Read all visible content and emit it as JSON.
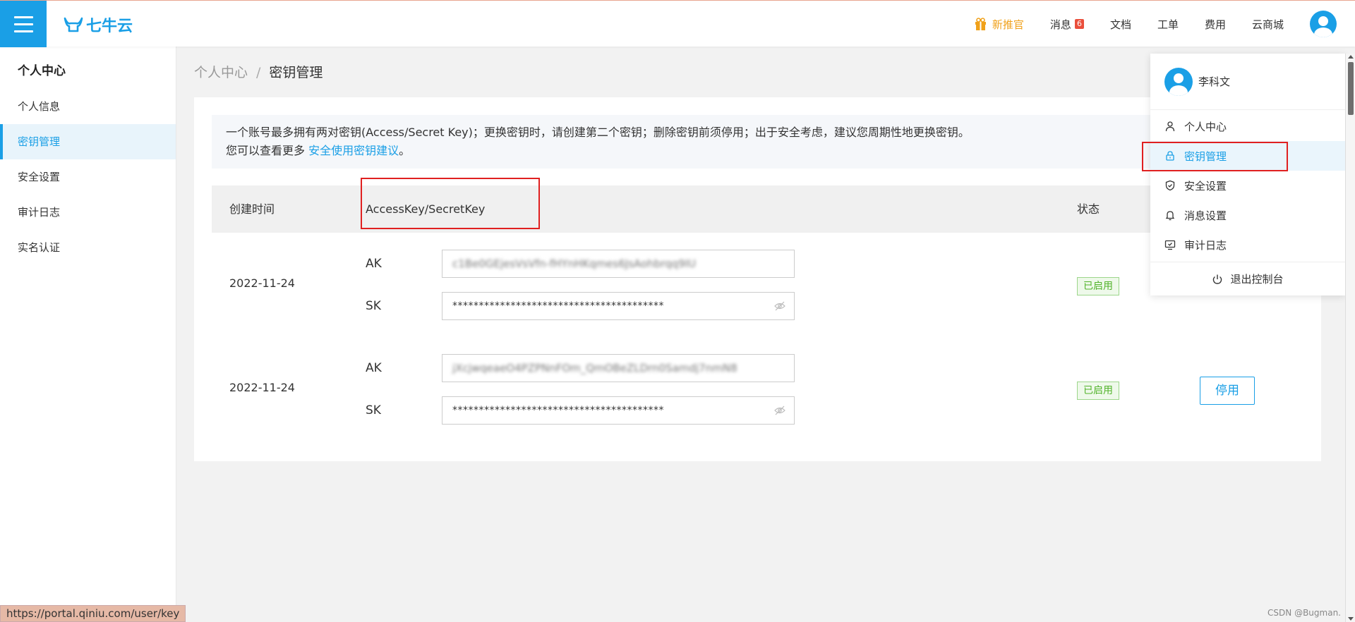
{
  "header": {
    "logo_text": "七牛云",
    "nav": {
      "promo": "新推官",
      "messages": "消息",
      "message_count": "6",
      "docs": "文档",
      "tickets": "工单",
      "billing": "费用",
      "market": "云商城"
    }
  },
  "sidebar": {
    "title": "个人中心",
    "items": [
      {
        "label": "个人信息"
      },
      {
        "label": "密钥管理"
      },
      {
        "label": "安全设置"
      },
      {
        "label": "审计日志"
      },
      {
        "label": "实名认证"
      }
    ]
  },
  "breadcrumb": {
    "root": "个人中心",
    "sep": "/",
    "current": "密钥管理"
  },
  "tip": {
    "line1": "一个账号最多拥有两对密钥(Access/Secret Key)；更换密钥时，请创建第二个密钥；删除密钥前须停用；出于安全考虑，建议您周期性地更换密钥。",
    "line2_prefix": "您可以查看更多",
    "link": "安全使用密钥建议",
    "line2_suffix": "。"
  },
  "table": {
    "headers": {
      "created": "创建时间",
      "keys": "AccessKey/SecretKey",
      "status": "状态"
    },
    "rows": [
      {
        "date": "2022-11-24",
        "ak_label": "AK",
        "ak_value": "c1Be0GEjesVsVfn-fHYnHKqmes6JsAohbrqq9IU",
        "sk_label": "SK",
        "sk_value": "****************************************",
        "status": "已启用",
        "action": ""
      },
      {
        "date": "2022-11-24",
        "ak_label": "AK",
        "ak_value": "jXcjwqeaeO4PZPNnFOm_QmOBeZLDrn0Samdj7nmN8",
        "sk_label": "SK",
        "sk_value": "****************************************",
        "status": "已启用",
        "action": "停用"
      }
    ]
  },
  "dropdown": {
    "username": "李科文",
    "items": [
      {
        "label": "个人中心"
      },
      {
        "label": "密钥管理"
      },
      {
        "label": "安全设置"
      },
      {
        "label": "消息设置"
      },
      {
        "label": "审计日志"
      }
    ],
    "logout": "退出控制台"
  },
  "status_bar_url": "https://portal.qiniu.com/user/key",
  "watermark": "CSDN @Bugman."
}
